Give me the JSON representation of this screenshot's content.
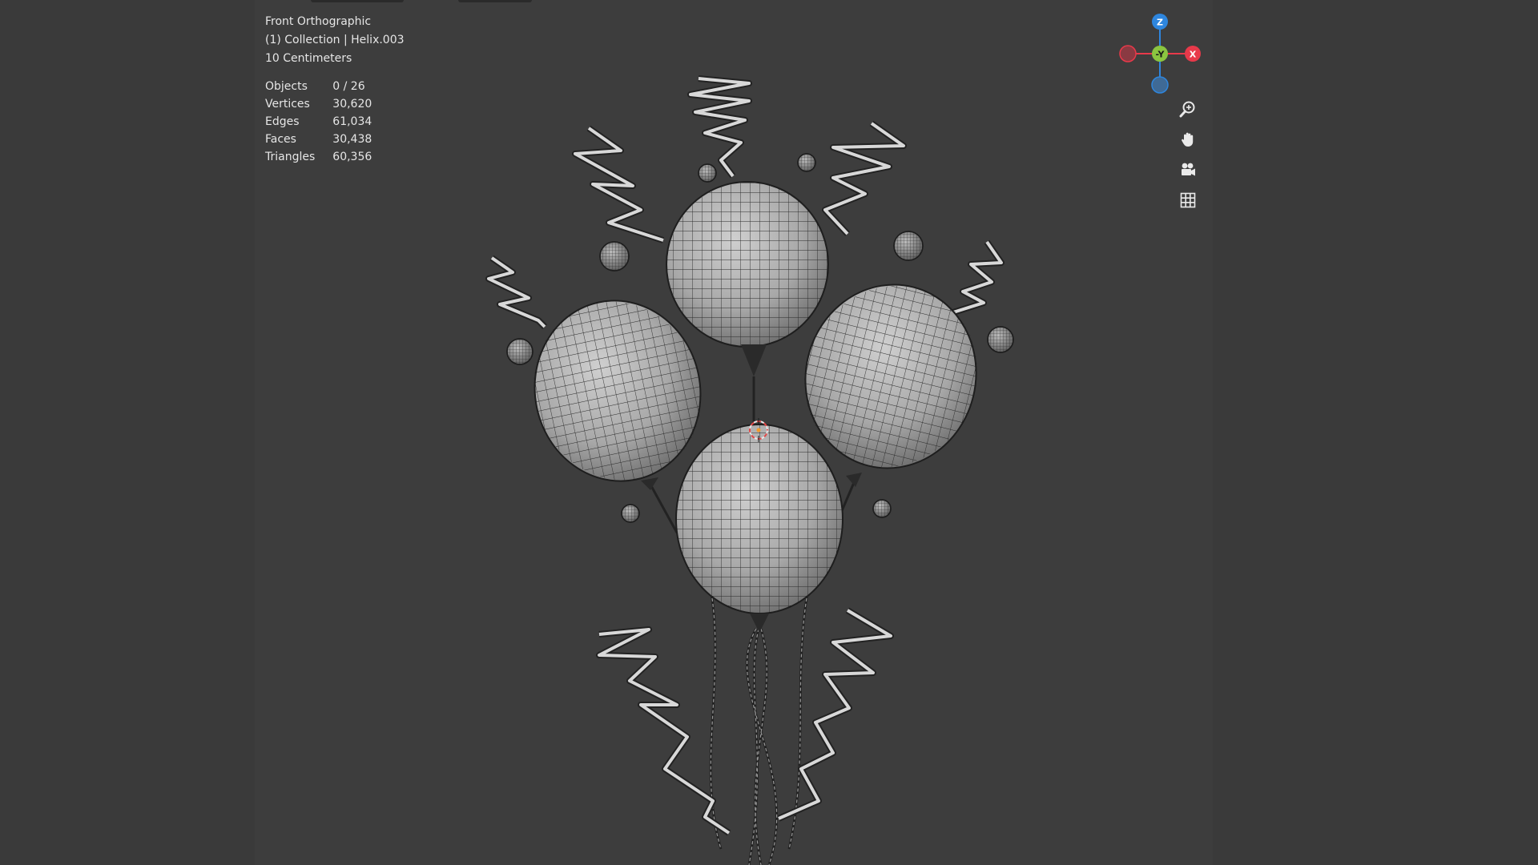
{
  "viewport": {
    "view_name": "Front Orthographic",
    "collection_line": "(1) Collection | Helix.003",
    "scale_label": "10 Centimeters"
  },
  "stats": {
    "rows": [
      {
        "label": "Objects",
        "value": "0 / 26"
      },
      {
        "label": "Vertices",
        "value": "30,620"
      },
      {
        "label": "Edges",
        "value": "61,034"
      },
      {
        "label": "Faces",
        "value": "30,438"
      },
      {
        "label": "Triangles",
        "value": "60,356"
      }
    ]
  },
  "axis_gizmo": {
    "z_label": "Z",
    "y_label": "-Y",
    "x_label": "X",
    "colors": {
      "x": "#e8394a",
      "y": "#8bc540",
      "z": "#2e86de"
    }
  },
  "navigation_tools": [
    {
      "name": "zoom-icon"
    },
    {
      "name": "pan-hand-icon"
    },
    {
      "name": "camera-icon"
    },
    {
      "name": "grid-icon"
    }
  ]
}
